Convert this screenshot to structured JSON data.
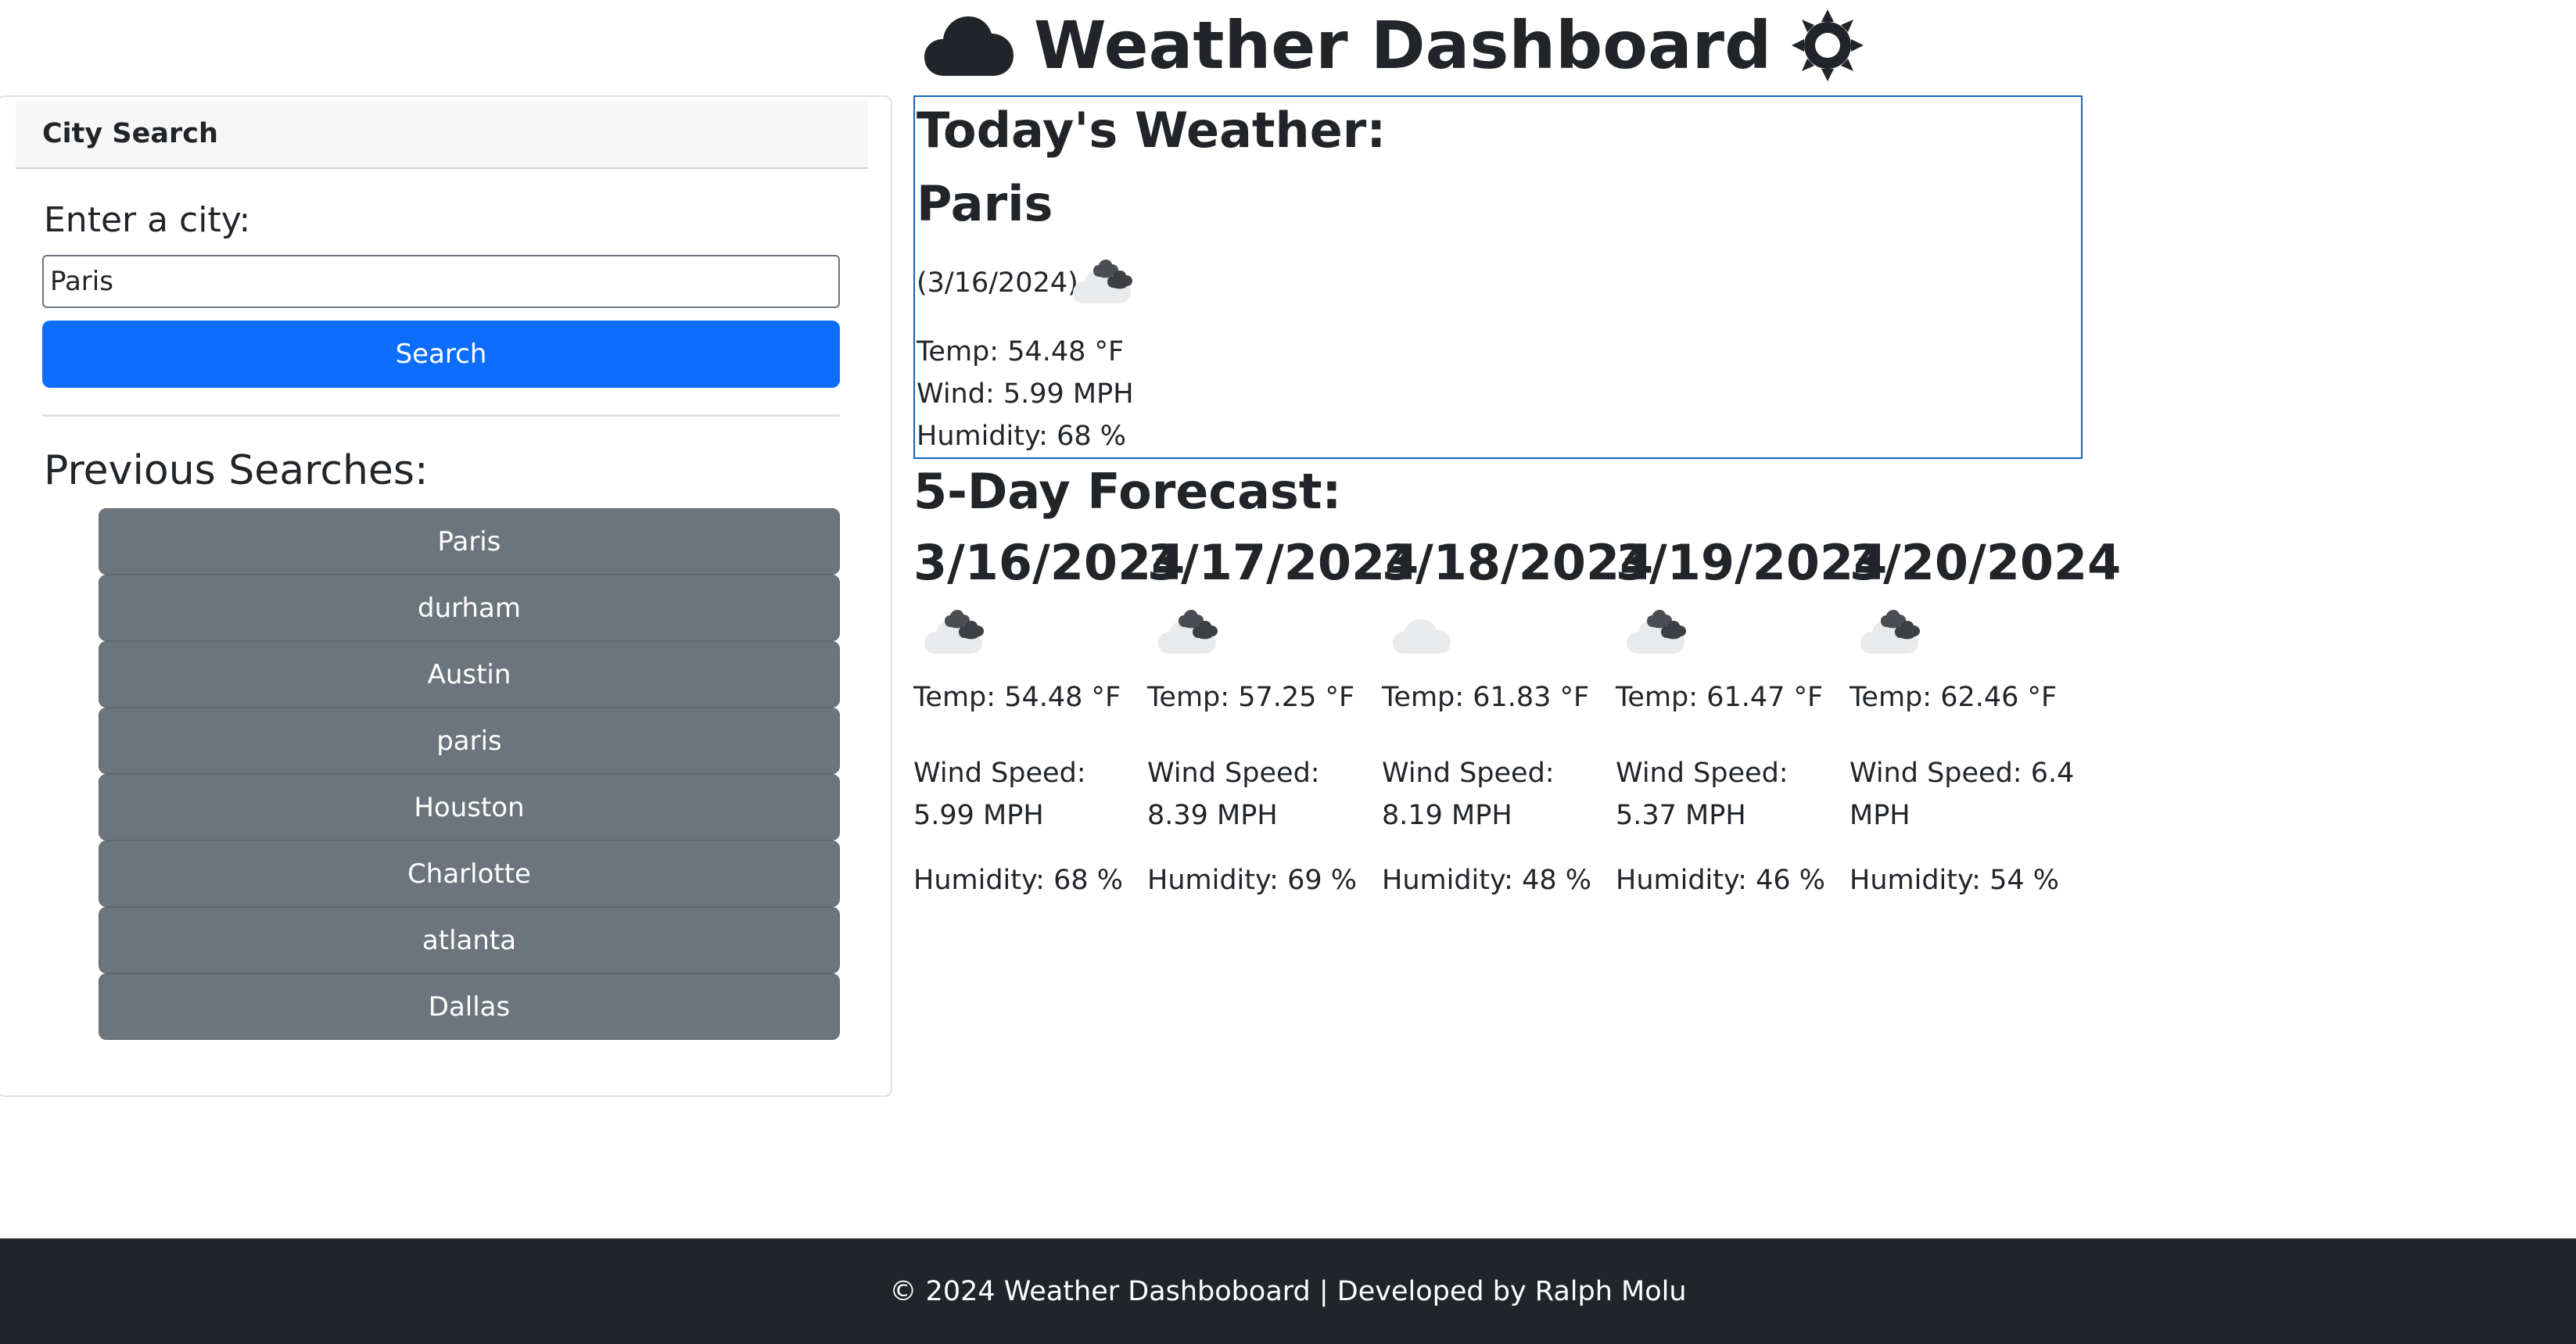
{
  "header": {
    "title": "Weather Dashboard",
    "left_icon": "cloud-icon",
    "right_icon": "sun-icon"
  },
  "sidebar": {
    "title": "City Search",
    "input_label": "Enter a city:",
    "input_value": "Paris",
    "search_label": "Search",
    "previous_title": "Previous Searches:",
    "previous": [
      "Paris",
      "durham",
      "Austin",
      "paris",
      "Houston",
      "Charlotte",
      "atlanta",
      "Dallas"
    ]
  },
  "today": {
    "title": "Today's Weather:",
    "city": "Paris",
    "date": "(3/16/2024)",
    "icon": "broken-clouds-icon",
    "temp": "Temp: 54.48 °F",
    "wind": "Wind: 5.99 MPH",
    "humidity": "Humidity: 68 %"
  },
  "forecast": {
    "title": "5-Day Forecast:",
    "days": [
      {
        "date": "3/16/2024",
        "icon": "broken-clouds-icon",
        "temp": "Temp: 54.48 °F",
        "wind": "Wind Speed: 5.99 MPH",
        "humidity": "Humidity: 68 %"
      },
      {
        "date": "3/17/2024",
        "icon": "broken-clouds-icon",
        "temp": "Temp: 57.25 °F",
        "wind": "Wind Speed: 8.39 MPH",
        "humidity": "Humidity: 69 %"
      },
      {
        "date": "3/18/2024",
        "icon": "few-clouds-icon",
        "temp": "Temp: 61.83 °F",
        "wind": "Wind Speed: 8.19 MPH",
        "humidity": "Humidity: 48 %"
      },
      {
        "date": "3/19/2024",
        "icon": "broken-clouds-icon",
        "temp": "Temp: 61.47 °F",
        "wind": "Wind Speed: 5.37 MPH",
        "humidity": "Humidity: 46 %"
      },
      {
        "date": "3/20/2024",
        "icon": "broken-clouds-icon",
        "temp": "Temp: 62.46 °F",
        "wind": "Wind Speed: 6.4 MPH",
        "humidity": "Humidity: 54 %"
      }
    ]
  },
  "footer": {
    "text": "© 2024 Weather Dashboboard | Developed by Ralph Molu"
  },
  "colors": {
    "primary": "#0d6efd",
    "secondary": "#6c757d",
    "footer_bg": "#212529",
    "today_border": "#1565c0"
  }
}
